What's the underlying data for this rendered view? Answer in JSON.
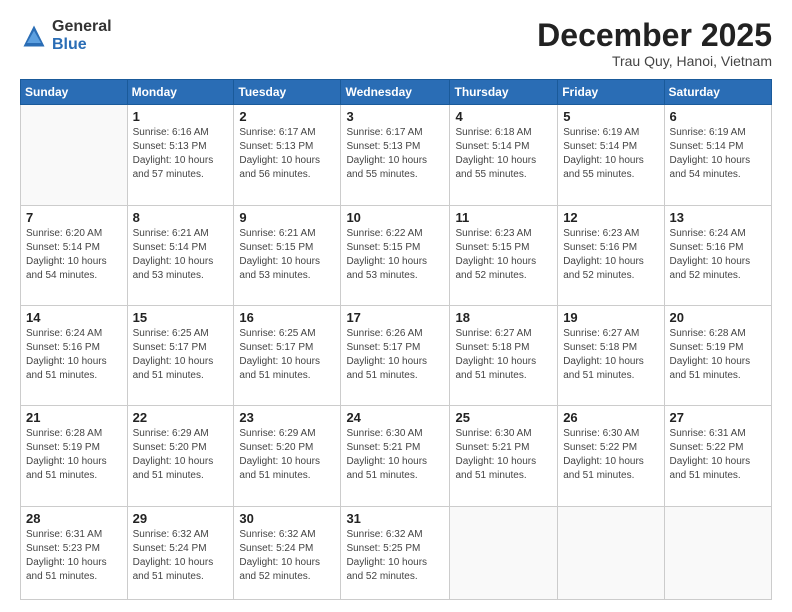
{
  "header": {
    "logo_general": "General",
    "logo_blue": "Blue",
    "month": "December 2025",
    "location": "Trau Quy, Hanoi, Vietnam"
  },
  "days_of_week": [
    "Sunday",
    "Monday",
    "Tuesday",
    "Wednesday",
    "Thursday",
    "Friday",
    "Saturday"
  ],
  "weeks": [
    [
      {
        "day": "",
        "info": ""
      },
      {
        "day": "1",
        "info": "Sunrise: 6:16 AM\nSunset: 5:13 PM\nDaylight: 10 hours\nand 57 minutes."
      },
      {
        "day": "2",
        "info": "Sunrise: 6:17 AM\nSunset: 5:13 PM\nDaylight: 10 hours\nand 56 minutes."
      },
      {
        "day": "3",
        "info": "Sunrise: 6:17 AM\nSunset: 5:13 PM\nDaylight: 10 hours\nand 55 minutes."
      },
      {
        "day": "4",
        "info": "Sunrise: 6:18 AM\nSunset: 5:14 PM\nDaylight: 10 hours\nand 55 minutes."
      },
      {
        "day": "5",
        "info": "Sunrise: 6:19 AM\nSunset: 5:14 PM\nDaylight: 10 hours\nand 55 minutes."
      },
      {
        "day": "6",
        "info": "Sunrise: 6:19 AM\nSunset: 5:14 PM\nDaylight: 10 hours\nand 54 minutes."
      }
    ],
    [
      {
        "day": "7",
        "info": "Sunrise: 6:20 AM\nSunset: 5:14 PM\nDaylight: 10 hours\nand 54 minutes."
      },
      {
        "day": "8",
        "info": "Sunrise: 6:21 AM\nSunset: 5:14 PM\nDaylight: 10 hours\nand 53 minutes."
      },
      {
        "day": "9",
        "info": "Sunrise: 6:21 AM\nSunset: 5:15 PM\nDaylight: 10 hours\nand 53 minutes."
      },
      {
        "day": "10",
        "info": "Sunrise: 6:22 AM\nSunset: 5:15 PM\nDaylight: 10 hours\nand 53 minutes."
      },
      {
        "day": "11",
        "info": "Sunrise: 6:23 AM\nSunset: 5:15 PM\nDaylight: 10 hours\nand 52 minutes."
      },
      {
        "day": "12",
        "info": "Sunrise: 6:23 AM\nSunset: 5:16 PM\nDaylight: 10 hours\nand 52 minutes."
      },
      {
        "day": "13",
        "info": "Sunrise: 6:24 AM\nSunset: 5:16 PM\nDaylight: 10 hours\nand 52 minutes."
      }
    ],
    [
      {
        "day": "14",
        "info": "Sunrise: 6:24 AM\nSunset: 5:16 PM\nDaylight: 10 hours\nand 51 minutes."
      },
      {
        "day": "15",
        "info": "Sunrise: 6:25 AM\nSunset: 5:17 PM\nDaylight: 10 hours\nand 51 minutes."
      },
      {
        "day": "16",
        "info": "Sunrise: 6:25 AM\nSunset: 5:17 PM\nDaylight: 10 hours\nand 51 minutes."
      },
      {
        "day": "17",
        "info": "Sunrise: 6:26 AM\nSunset: 5:17 PM\nDaylight: 10 hours\nand 51 minutes."
      },
      {
        "day": "18",
        "info": "Sunrise: 6:27 AM\nSunset: 5:18 PM\nDaylight: 10 hours\nand 51 minutes."
      },
      {
        "day": "19",
        "info": "Sunrise: 6:27 AM\nSunset: 5:18 PM\nDaylight: 10 hours\nand 51 minutes."
      },
      {
        "day": "20",
        "info": "Sunrise: 6:28 AM\nSunset: 5:19 PM\nDaylight: 10 hours\nand 51 minutes."
      }
    ],
    [
      {
        "day": "21",
        "info": "Sunrise: 6:28 AM\nSunset: 5:19 PM\nDaylight: 10 hours\nand 51 minutes."
      },
      {
        "day": "22",
        "info": "Sunrise: 6:29 AM\nSunset: 5:20 PM\nDaylight: 10 hours\nand 51 minutes."
      },
      {
        "day": "23",
        "info": "Sunrise: 6:29 AM\nSunset: 5:20 PM\nDaylight: 10 hours\nand 51 minutes."
      },
      {
        "day": "24",
        "info": "Sunrise: 6:30 AM\nSunset: 5:21 PM\nDaylight: 10 hours\nand 51 minutes."
      },
      {
        "day": "25",
        "info": "Sunrise: 6:30 AM\nSunset: 5:21 PM\nDaylight: 10 hours\nand 51 minutes."
      },
      {
        "day": "26",
        "info": "Sunrise: 6:30 AM\nSunset: 5:22 PM\nDaylight: 10 hours\nand 51 minutes."
      },
      {
        "day": "27",
        "info": "Sunrise: 6:31 AM\nSunset: 5:22 PM\nDaylight: 10 hours\nand 51 minutes."
      }
    ],
    [
      {
        "day": "28",
        "info": "Sunrise: 6:31 AM\nSunset: 5:23 PM\nDaylight: 10 hours\nand 51 minutes."
      },
      {
        "day": "29",
        "info": "Sunrise: 6:32 AM\nSunset: 5:24 PM\nDaylight: 10 hours\nand 51 minutes."
      },
      {
        "day": "30",
        "info": "Sunrise: 6:32 AM\nSunset: 5:24 PM\nDaylight: 10 hours\nand 52 minutes."
      },
      {
        "day": "31",
        "info": "Sunrise: 6:32 AM\nSunset: 5:25 PM\nDaylight: 10 hours\nand 52 minutes."
      },
      {
        "day": "",
        "info": ""
      },
      {
        "day": "",
        "info": ""
      },
      {
        "day": "",
        "info": ""
      }
    ]
  ]
}
